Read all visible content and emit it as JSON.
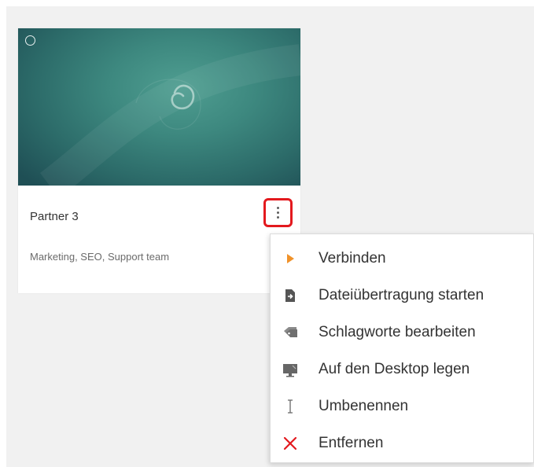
{
  "card": {
    "title": "Partner 3",
    "tags": "Marketing, SEO, Support team",
    "thumbnail_icon": "debian-swirl-icon"
  },
  "menu": {
    "items": [
      {
        "label": "Verbinden",
        "icon": "play-icon",
        "icon_color": "#f0922a"
      },
      {
        "label": "Dateiübertragung starten",
        "icon": "file-transfer-icon",
        "icon_color": "#555555"
      },
      {
        "label": "Schlagworte bearbeiten",
        "icon": "tag-icon",
        "icon_color": "#777777"
      },
      {
        "label": "Auf den Desktop legen",
        "icon": "desktop-icon",
        "icon_color": "#666666"
      },
      {
        "label": "Umbenennen",
        "icon": "text-cursor-icon",
        "icon_color": "#666666"
      },
      {
        "label": "Entfernen",
        "icon": "close-icon",
        "icon_color": "#e3191e"
      }
    ]
  },
  "colors": {
    "highlight": "#e3191e",
    "thumbnail": "#3d887f",
    "background": "#f1f1f1"
  }
}
